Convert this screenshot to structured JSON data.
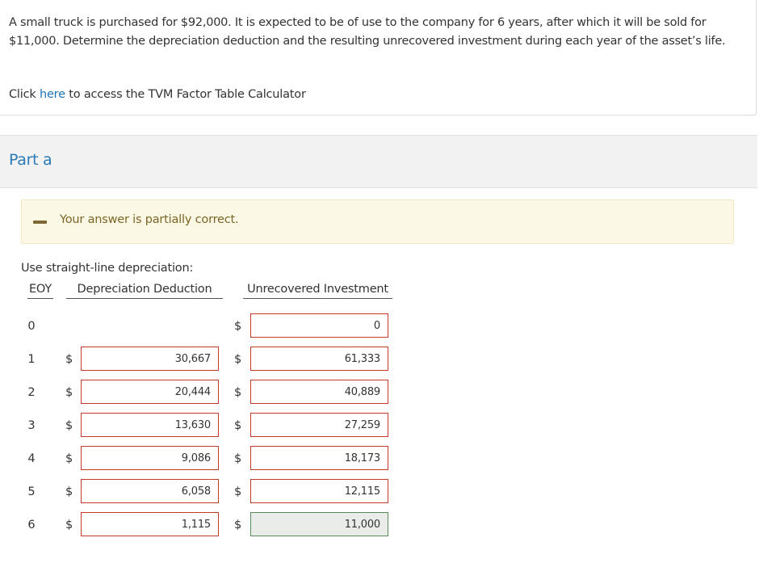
{
  "question": "A small truck is purchased for $92,000. It is expected to be of use to the company for 6 years, after which it will be sold for $11,000. Determine the depreciation deduction and the resulting unrecovered investment during each year of the asset’s life.",
  "tvm": {
    "prefix": "Click ",
    "link": "here",
    "suffix": " to access the TVM Factor Table Calculator"
  },
  "part": {
    "title": "Part a"
  },
  "feedback": {
    "text": "Your answer is partially correct."
  },
  "instructions": "Use straight-line depreciation:",
  "columns": {
    "eoy": "EOY",
    "depreciation": "Depreciation Deduction",
    "unrecovered": "Unrecovered Investment"
  },
  "currency_symbol": "$",
  "colors": {
    "incorrect_border": "#c0392b",
    "correct_border": "#5a8a5a",
    "link": "#1a73b8",
    "part_title": "#2b7bb9",
    "feedback_bg": "#fcf8e6"
  },
  "rows": [
    {
      "eoy": "0",
      "depreciation": null,
      "unrecovered": "0"
    },
    {
      "eoy": "1",
      "depreciation": "30,667",
      "unrecovered": "61,333"
    },
    {
      "eoy": "2",
      "depreciation": "20,444",
      "unrecovered": "40,889"
    },
    {
      "eoy": "3",
      "depreciation": "13,630",
      "unrecovered": "27,259"
    },
    {
      "eoy": "4",
      "depreciation": "9,086",
      "unrecovered": "18,173"
    },
    {
      "eoy": "5",
      "depreciation": "6,058",
      "unrecovered": "12,115"
    },
    {
      "eoy": "6",
      "depreciation": "1,115",
      "unrecovered": "11,000",
      "unrecovered_correct": true
    }
  ]
}
